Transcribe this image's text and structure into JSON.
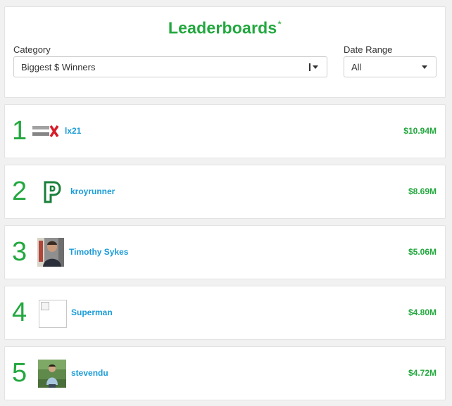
{
  "header": {
    "title": "Leaderboards",
    "title_mark": "*",
    "category_label": "Category",
    "category_value": "Biggest $ Winners",
    "daterange_label": "Date Range",
    "daterange_value": "All"
  },
  "colors": {
    "accent_green": "#23a83f",
    "link_blue": "#1a9cd8"
  },
  "leaders": [
    {
      "rank": "1",
      "name": "lx21",
      "amount": "$10.94M",
      "avatar": "lucky-strike-logo"
    },
    {
      "rank": "2",
      "name": "kroyrunner",
      "amount": "$8.69M",
      "avatar": "p-logo"
    },
    {
      "rank": "3",
      "name": "Timothy Sykes",
      "amount": "$5.06M",
      "avatar": "profile-photo"
    },
    {
      "rank": "4",
      "name": "Superman",
      "amount": "$4.80M",
      "avatar": "broken-image"
    },
    {
      "rank": "5",
      "name": "stevendu",
      "amount": "$4.72M",
      "avatar": "profile-photo"
    }
  ]
}
